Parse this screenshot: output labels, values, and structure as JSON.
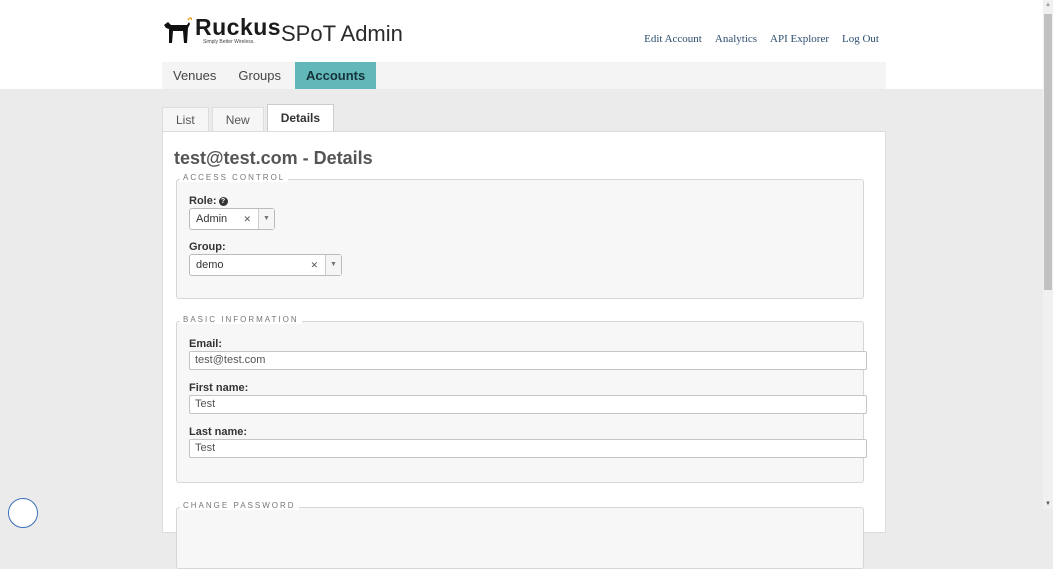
{
  "brand": {
    "logo_text": "Ruckus",
    "logo_tagline": "Simply Better Wireless.",
    "app_title": "SPoT Admin"
  },
  "top_links": [
    "Edit Account",
    "Analytics",
    "API Explorer",
    "Log Out"
  ],
  "main_nav": {
    "venues": "Venues",
    "groups": "Groups",
    "accounts": "Accounts",
    "active": "Accounts"
  },
  "sub_tabs": {
    "list": "List",
    "new": "New",
    "details": "Details",
    "active": "Details"
  },
  "page_title": "test@test.com - Details",
  "access_control": {
    "legend": "ACCESS CONTROL",
    "role_label": "Role:",
    "role_value": "Admin",
    "group_label": "Group:",
    "group_value": "demo"
  },
  "basic_information": {
    "legend": "BASIC INFORMATION",
    "email_label": "Email:",
    "email_value": "test@test.com",
    "first_name_label": "First name:",
    "first_name_value": "Test",
    "last_name_label": "Last name:",
    "last_name_value": "Test"
  },
  "change_password": {
    "legend": "CHANGE PASSWORD"
  },
  "icons": {
    "role_help": "question-circle-icon",
    "clear": "x-icon",
    "dropdown": "chevron-down-icon"
  },
  "colors": {
    "active_nav": "#62b7b9",
    "link": "#2b4d6e",
    "page_bg": "#ebebeb"
  }
}
